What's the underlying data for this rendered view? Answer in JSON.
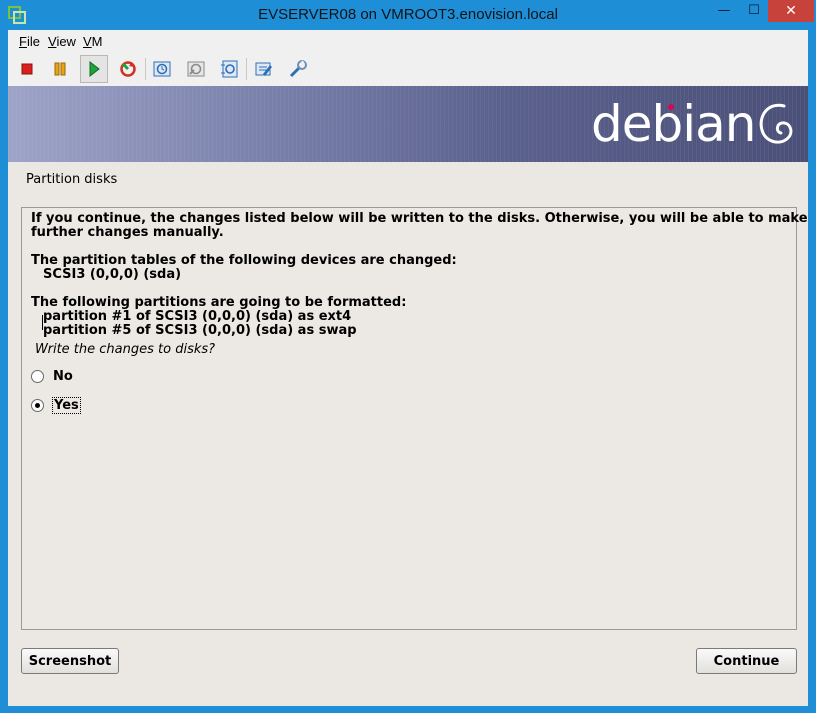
{
  "window": {
    "title": "EVSERVER08 on VMROOT3.enovision.local",
    "minimize_glyph": "—",
    "maximize_glyph": "☐",
    "close_glyph": "✕"
  },
  "menu": [
    {
      "label": "File",
      "underline": "F",
      "rest": "ile"
    },
    {
      "label": "View",
      "underline": "V",
      "rest": "iew"
    },
    {
      "label": "VM",
      "underline": "V",
      "rest": "M"
    }
  ],
  "toolbar": {
    "icons": [
      "stop-icon",
      "pause-icon",
      "start-icon",
      "reset-icon",
      "snapshot-icon",
      "revert-snapshot-icon",
      "manage-snapshots-icon",
      "settings-icon",
      "tools-icon"
    ],
    "colors": {
      "stop": "#d8201c",
      "pause": "#e7a312",
      "start": "#1ea23a",
      "reset": "#d23027",
      "accent": "#2f6fb5"
    }
  },
  "installer": {
    "brand": "debian",
    "section_title": "Partition disks",
    "intro_line1": "If you continue, the changes listed below will be written to the disks. Otherwise, you will be able to make",
    "intro_line2": "further changes manually.",
    "tables_header": "The partition tables of the following devices are changed:",
    "tables_device": "SCSI3 (0,0,0) (sda)",
    "format_header": "The following partitions are going to be formatted:",
    "format_line1": "partition #1 of SCSI3 (0,0,0) (sda) as ext4",
    "format_line2": "partition #5 of SCSI3 (0,0,0) (sda) as swap",
    "question": "Write the changes to disks?",
    "options": [
      {
        "label": "No",
        "selected": false
      },
      {
        "label": "Yes",
        "selected": true
      }
    ],
    "screenshot_button": "Screenshot",
    "continue_button": "Continue"
  }
}
